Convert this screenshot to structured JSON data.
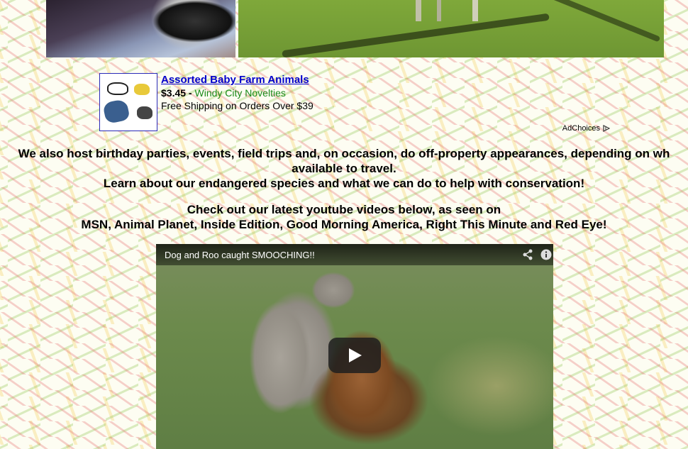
{
  "ad": {
    "title": "Assorted Baby Farm Animals",
    "price": "$3.45",
    "separator": " - ",
    "seller": "Windy City Novelties",
    "shipping": "Free Shipping on Orders Over $39",
    "adchoices_label": "AdChoices"
  },
  "content": {
    "intro_line1": "We also host birthday parties, events, field trips and, on occasion, do off-property appearances, depending on wh",
    "intro_line2": "available to travel.",
    "conservation": "Learn about our endangered species and what we can do to help with conservation!",
    "youtube_line1": "Check out our latest youtube videos below, as seen on",
    "youtube_line2": "MSN, Animal Planet, Inside Edition, Good Morning America, Right This Minute and Red Eye!"
  },
  "video": {
    "title": "Dog and Roo caught SMOOCHING!!"
  },
  "colors": {
    "ad_link": "#0000cc",
    "seller_green": "#1a8a1a",
    "ad_border": "#2a2ab8"
  }
}
